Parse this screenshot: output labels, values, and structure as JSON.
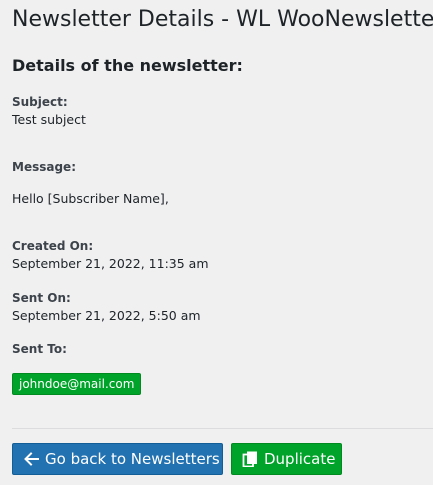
{
  "page": {
    "title": "Newsletter Details - WL WooNewsletter"
  },
  "details": {
    "heading": "Details of the newsletter:",
    "subject_label": "Subject:",
    "subject_value": "Test subject",
    "message_label": "Message:",
    "message_value": "Hello [Subscriber Name],",
    "created_label": "Created On:",
    "created_value": "September 21, 2022, 11:35 am",
    "sent_on_label": "Sent On:",
    "sent_on_value": "September 21, 2022, 5:50 am",
    "sent_to_label": "Sent To:",
    "recipients": [
      "johndoe@mail.com"
    ]
  },
  "actions": {
    "back_label": "Go back to Newsletters",
    "back_icon": "arrow-left-icon",
    "duplicate_label": "Duplicate",
    "duplicate_icon": "copy-icon"
  },
  "colors": {
    "primary_button": "#2271b1",
    "success_button": "#00a32a",
    "background": "#f0f0f1"
  }
}
